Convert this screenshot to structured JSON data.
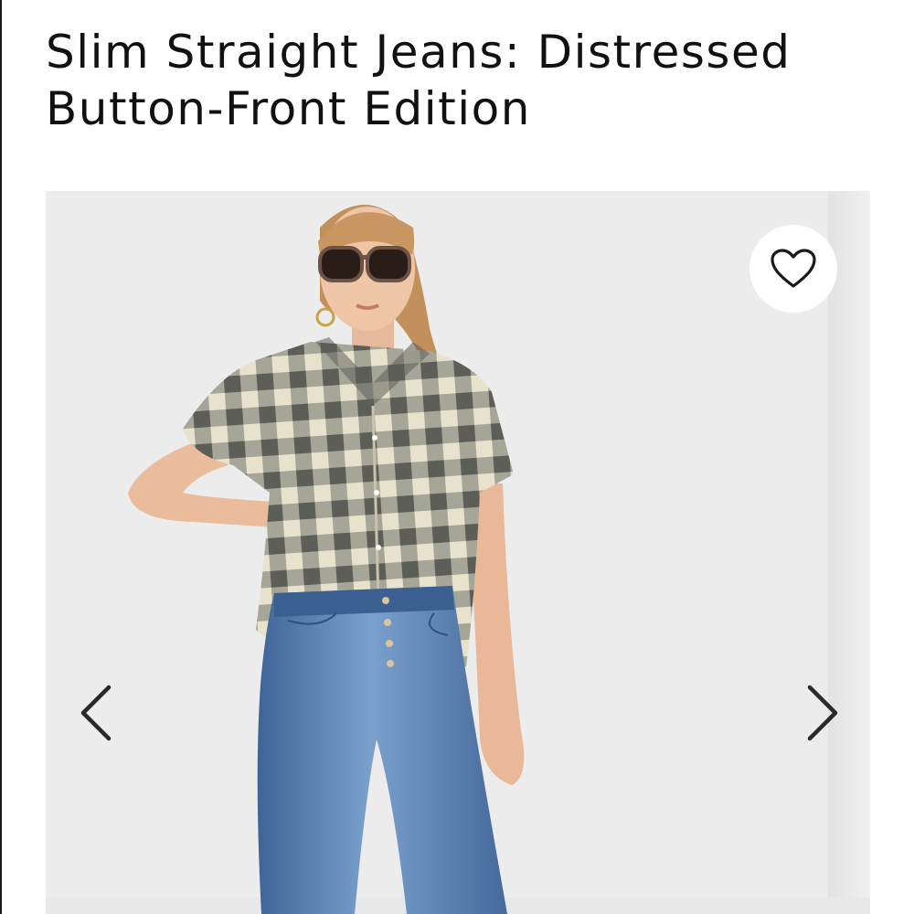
{
  "product": {
    "title": "Slim Straight Jeans: Distressed Button-Front Edition"
  },
  "gallery": {
    "image_subject": "model wearing gingham shirt, sunglasses and blue button-front jeans",
    "wishlist_icon": "heart-outline-icon",
    "prev_icon": "chevron-left-icon",
    "next_icon": "chevron-right-icon"
  },
  "colors": {
    "text": "#111111",
    "background": "#ffffff",
    "photo_background": "#ececec",
    "denim": "#4f74a6",
    "gingham_dark": "#6e7068",
    "gingham_light": "#e8e2cc",
    "hair": "#c2905a"
  }
}
